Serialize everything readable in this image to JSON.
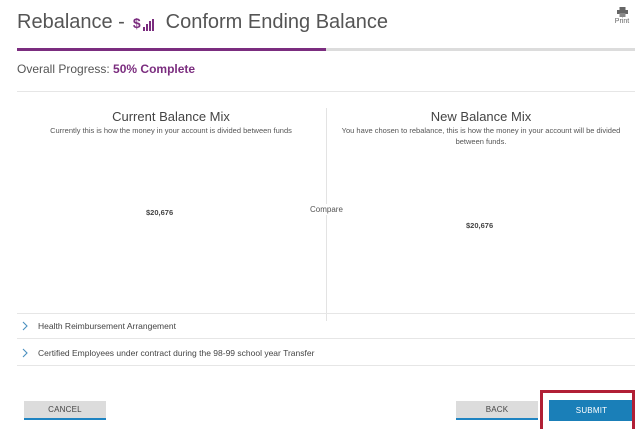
{
  "header": {
    "title_prefix": "Rebalance -",
    "dollar_icon_glyph": "$",
    "step_title": "Conform Ending Balance",
    "print_label": "Print",
    "icons": {
      "step": "dollar-bars-icon",
      "print": "printer-icon"
    }
  },
  "progress": {
    "label": "Overall Progress:",
    "value_text": "50% Complete",
    "fraction": 0.5,
    "accent_color": "#7b2d7f",
    "track_color": "#dcdcdc"
  },
  "balance": {
    "current": {
      "title": "Current Balance Mix",
      "description": "Currently this is how the money in your account is divided between funds",
      "amount": "$20,676"
    },
    "new": {
      "title": "New Balance Mix",
      "description": "You have chosen to rebalance, this is how the money in your account will be divided between funds.",
      "amount": "$20,676"
    },
    "compare_label": "Compare"
  },
  "accounts": [
    {
      "label": "Health Reimbursement Arrangement",
      "icon": "chevron-right-icon"
    },
    {
      "label": "Certified Employees under contract during the 98-99 school year Transfer",
      "icon": "chevron-right-icon"
    }
  ],
  "actions": {
    "cancel_label": "CANCEL",
    "back_label": "BACK",
    "submit_label": "SUBMIT",
    "submit_color": "#1a7fb8",
    "highlight_color": "#b11f35"
  }
}
